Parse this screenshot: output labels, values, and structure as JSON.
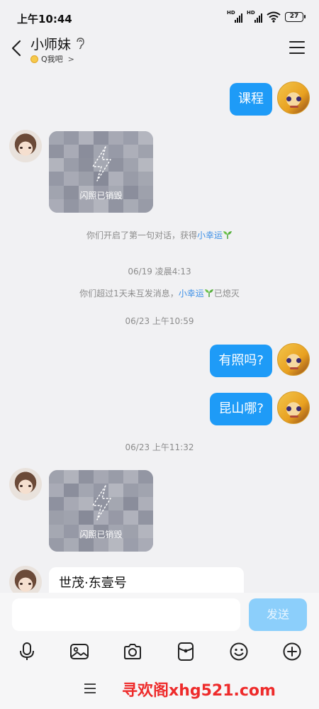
{
  "status_bar": {
    "time": "上午10:44",
    "signal_label": "HD",
    "battery": "27"
  },
  "header": {
    "title": "小师妹",
    "subtitle": "Q我吧",
    "subtitle_chevron": ">"
  },
  "messages": {
    "m1": {
      "text": "课程"
    },
    "flash1": {
      "label": "闪照已销毁"
    },
    "sys1": {
      "prefix": "你们开启了第一句对话，获得",
      "link": "小幸运"
    },
    "ts1": "06/19 凌晨4:13",
    "sys2": {
      "prefix": "你们超过1天未互发消息，",
      "link": "小幸运",
      "suffix": "已熄灭"
    },
    "ts2": "06/23 上午10:59",
    "m2": {
      "text": "有照吗?"
    },
    "m3": {
      "text": "昆山哪?"
    },
    "ts3": "06/23 上午11:32",
    "flash2": {
      "label": "闪照已销毁"
    },
    "m4": {
      "text": "世茂·东壹号"
    }
  },
  "input": {
    "placeholder": "",
    "send_label": "发送"
  },
  "toolbar": [
    "mic-icon",
    "image-icon",
    "camera-icon",
    "red-packet-icon",
    "emoji-icon",
    "plus-icon"
  ],
  "nav": {
    "watermark": "寻欢阁xhg521.com"
  },
  "colors": {
    "accent": "#1e9bf7",
    "send_disabled": "#8ccffb",
    "link": "#3a8ee6",
    "watermark": "#ee2b2b"
  }
}
